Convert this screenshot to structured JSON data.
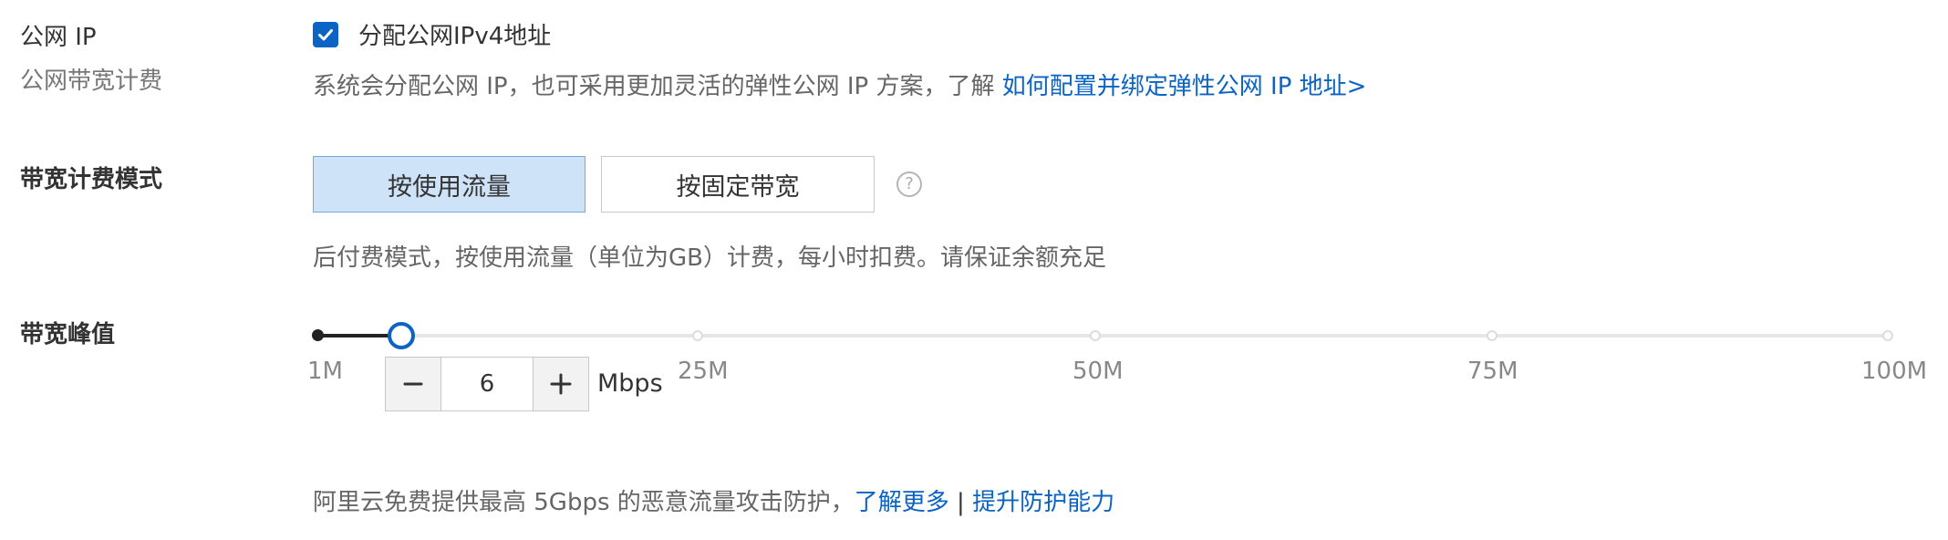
{
  "public_ip": {
    "label": "公网 IP",
    "sublabel": "公网带宽计费",
    "checkbox_label": "分配公网IPv4地址",
    "checked": true,
    "desc": "系统会分配公网 IP，也可采用更加灵活的弹性公网 IP 方案，了解 ",
    "link": "如何配置并绑定弹性公网 IP 地址>"
  },
  "billing": {
    "label": "带宽计费模式",
    "options": [
      "按使用流量",
      "按固定带宽"
    ],
    "selected": "按使用流量",
    "desc": "后付费模式，按使用流量（单位为GB）计费，每小时扣费。请保证余额充足"
  },
  "bandwidth": {
    "label": "带宽峰值",
    "ticks": [
      "1M",
      "25M",
      "50M",
      "75M",
      "100M"
    ],
    "value": "6",
    "unit": "Mbps"
  },
  "protection": {
    "text": "阿里云免费提供最高 5Gbps 的恶意流量攻击防护，",
    "link_more": "了解更多",
    "separator": " | ",
    "link_upgrade": "提升防护能力"
  },
  "colors": {
    "accent": "#0b63c4",
    "selected_bg": "#cfe3f8"
  },
  "icons": {
    "checkbox": "check-icon",
    "help": "question-circle-icon",
    "minus": "minus-icon",
    "plus": "plus-icon"
  }
}
